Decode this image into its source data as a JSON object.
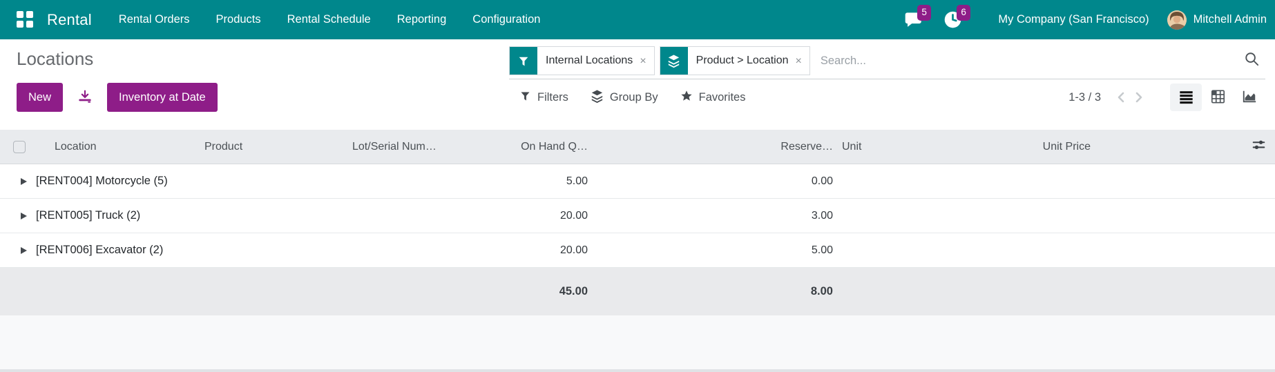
{
  "navbar": {
    "brand": "Rental",
    "menu_items": [
      "Rental Orders",
      "Products",
      "Rental Schedule",
      "Reporting",
      "Configuration"
    ],
    "messages_badge": "5",
    "activities_badge": "6",
    "company": "My Company (San Francisco)",
    "user_name": "Mitchell Admin"
  },
  "page": {
    "title": "Locations"
  },
  "search": {
    "facets": [
      {
        "icon": "filter-funnel-icon",
        "label": "Internal Locations",
        "remove": "×"
      },
      {
        "icon": "group-by-layers-icon",
        "label": "Product > Location",
        "remove": "×"
      }
    ],
    "placeholder": "Search..."
  },
  "actions": {
    "new": "New",
    "inventory_at_date": "Inventory at Date",
    "filters": "Filters",
    "group_by": "Group By",
    "favorites": "Favorites"
  },
  "pager": {
    "text": "1-3 / 3"
  },
  "table": {
    "columns": [
      "Location",
      "Product",
      "Lot/Serial Num…",
      "On Hand Q…",
      "Reserve…",
      "Unit",
      "Unit Price"
    ],
    "rows": [
      {
        "location": "[RENT004] Motorcycle (5)",
        "on_hand": "5.00",
        "reserved": "0.00",
        "unit": "",
        "unit_price": ""
      },
      {
        "location": "[RENT005] Truck (2)",
        "on_hand": "20.00",
        "reserved": "3.00",
        "unit": "",
        "unit_price": ""
      },
      {
        "location": "[RENT006] Excavator (2)",
        "on_hand": "20.00",
        "reserved": "5.00",
        "unit": "",
        "unit_price": ""
      }
    ],
    "totals": {
      "on_hand": "45.00",
      "reserved": "8.00"
    }
  },
  "colors": {
    "navbar_teal": "#00878c",
    "primary_purple": "#8e1d88",
    "badge_purple": "#8e1d88"
  }
}
